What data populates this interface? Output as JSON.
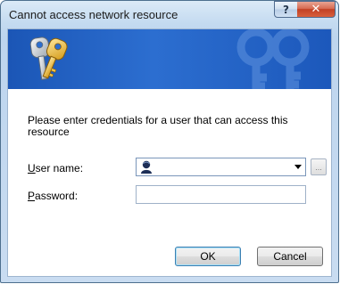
{
  "window": {
    "title": "Cannot access network resource",
    "help_glyph": "?",
    "close_glyph": "✕"
  },
  "banner": {
    "icon": "keys-icon",
    "watermark_icon": "keys-watermark-icon"
  },
  "prompt": "Please enter credentials for a user that can access this resource",
  "fields": {
    "username": {
      "label_mnemonic": "U",
      "label_rest": "ser name:",
      "value": "",
      "user_icon": "user-icon",
      "browse_label": "..."
    },
    "password": {
      "label_mnemonic": "P",
      "label_rest": "assword:",
      "value": ""
    }
  },
  "buttons": {
    "ok": "OK",
    "cancel": "Cancel"
  },
  "colors": {
    "banner": "#2c6ed0",
    "frame": "#c3daf0",
    "close_button": "#c24024"
  }
}
